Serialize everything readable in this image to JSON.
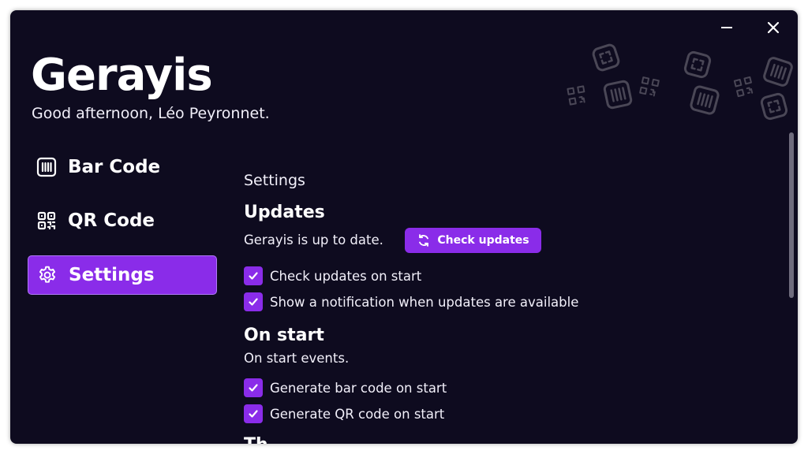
{
  "app": {
    "title": "Gerayis",
    "greeting": "Good afternoon, Léo Peyronnet."
  },
  "window_controls": {
    "minimize_icon": "minimize-icon",
    "close_icon": "close-icon"
  },
  "nav": {
    "items": [
      {
        "label": "Bar Code",
        "icon": "barcode-icon",
        "active": false
      },
      {
        "label": "QR Code",
        "icon": "qrcode-icon",
        "active": false
      },
      {
        "label": "Settings",
        "icon": "gear-icon",
        "active": true
      }
    ]
  },
  "settings": {
    "section_title": "Settings",
    "updates": {
      "heading": "Updates",
      "status": "Gerayis is up to date.",
      "check_button": "Check updates",
      "options": [
        {
          "label": "Check updates on start",
          "checked": true
        },
        {
          "label": "Show a notification when updates are available",
          "checked": true
        }
      ]
    },
    "on_start": {
      "heading": "On start",
      "description": "On start events.",
      "options": [
        {
          "label": "Generate bar code on start",
          "checked": true
        },
        {
          "label": "Generate QR code on start",
          "checked": true
        }
      ]
    }
  },
  "colors": {
    "background": "#0e0b1f",
    "accent": "#8a2ce9",
    "text": "#ffffff",
    "decoration": "#4a4756"
  }
}
